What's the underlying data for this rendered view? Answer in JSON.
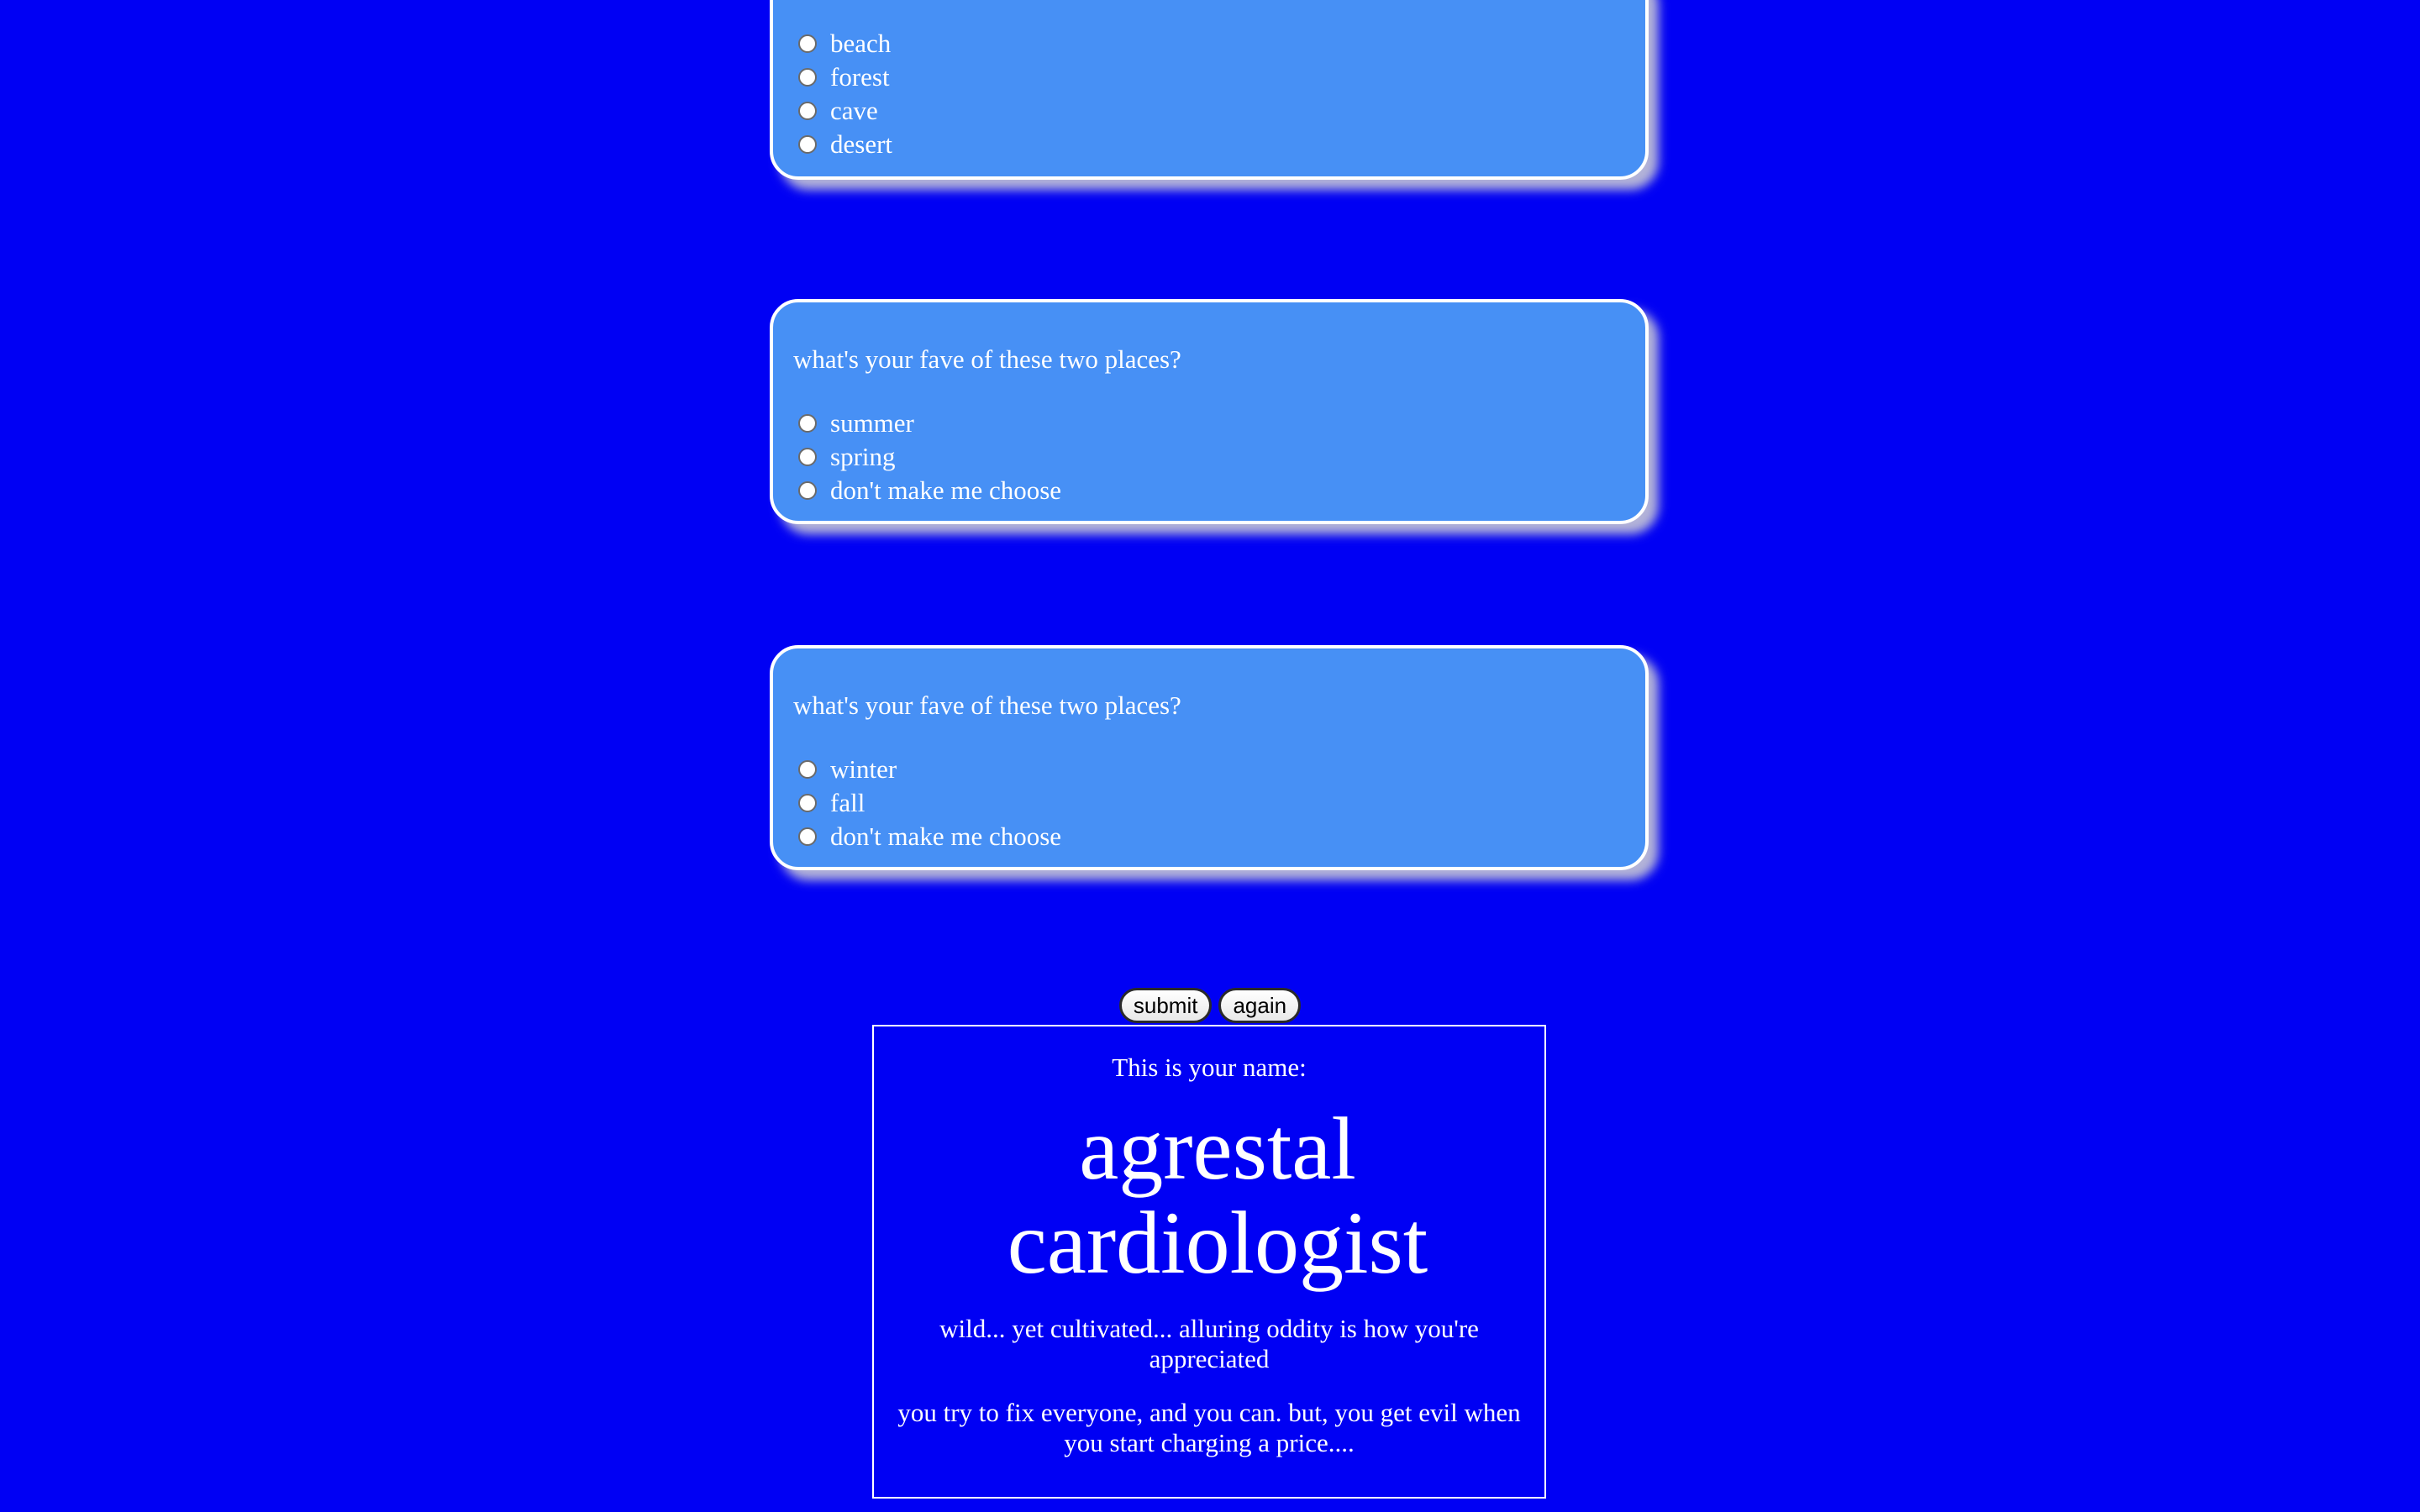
{
  "colors": {
    "background": "#0000f4",
    "card": "#4790f5",
    "text": "#ffffff"
  },
  "questions": [
    {
      "question": "",
      "options": [
        "beach",
        "forest",
        "cave",
        "desert"
      ]
    },
    {
      "question": "what's your fave of these two places?",
      "options": [
        "summer",
        "spring",
        "don't make me choose"
      ]
    },
    {
      "question": "what's your fave of these two places?",
      "options": [
        "winter",
        "fall",
        "don't make me choose"
      ]
    }
  ],
  "buttons": {
    "submit_label": "submit",
    "again_label": "again"
  },
  "result": {
    "intro": "This is your name:",
    "name": "agrestal cardiologist",
    "description": "wild... yet cultivated... alluring oddity is how you're appreciated",
    "description2": "you try to fix everyone, and you can. but, you get evil when you start charging a price...."
  }
}
